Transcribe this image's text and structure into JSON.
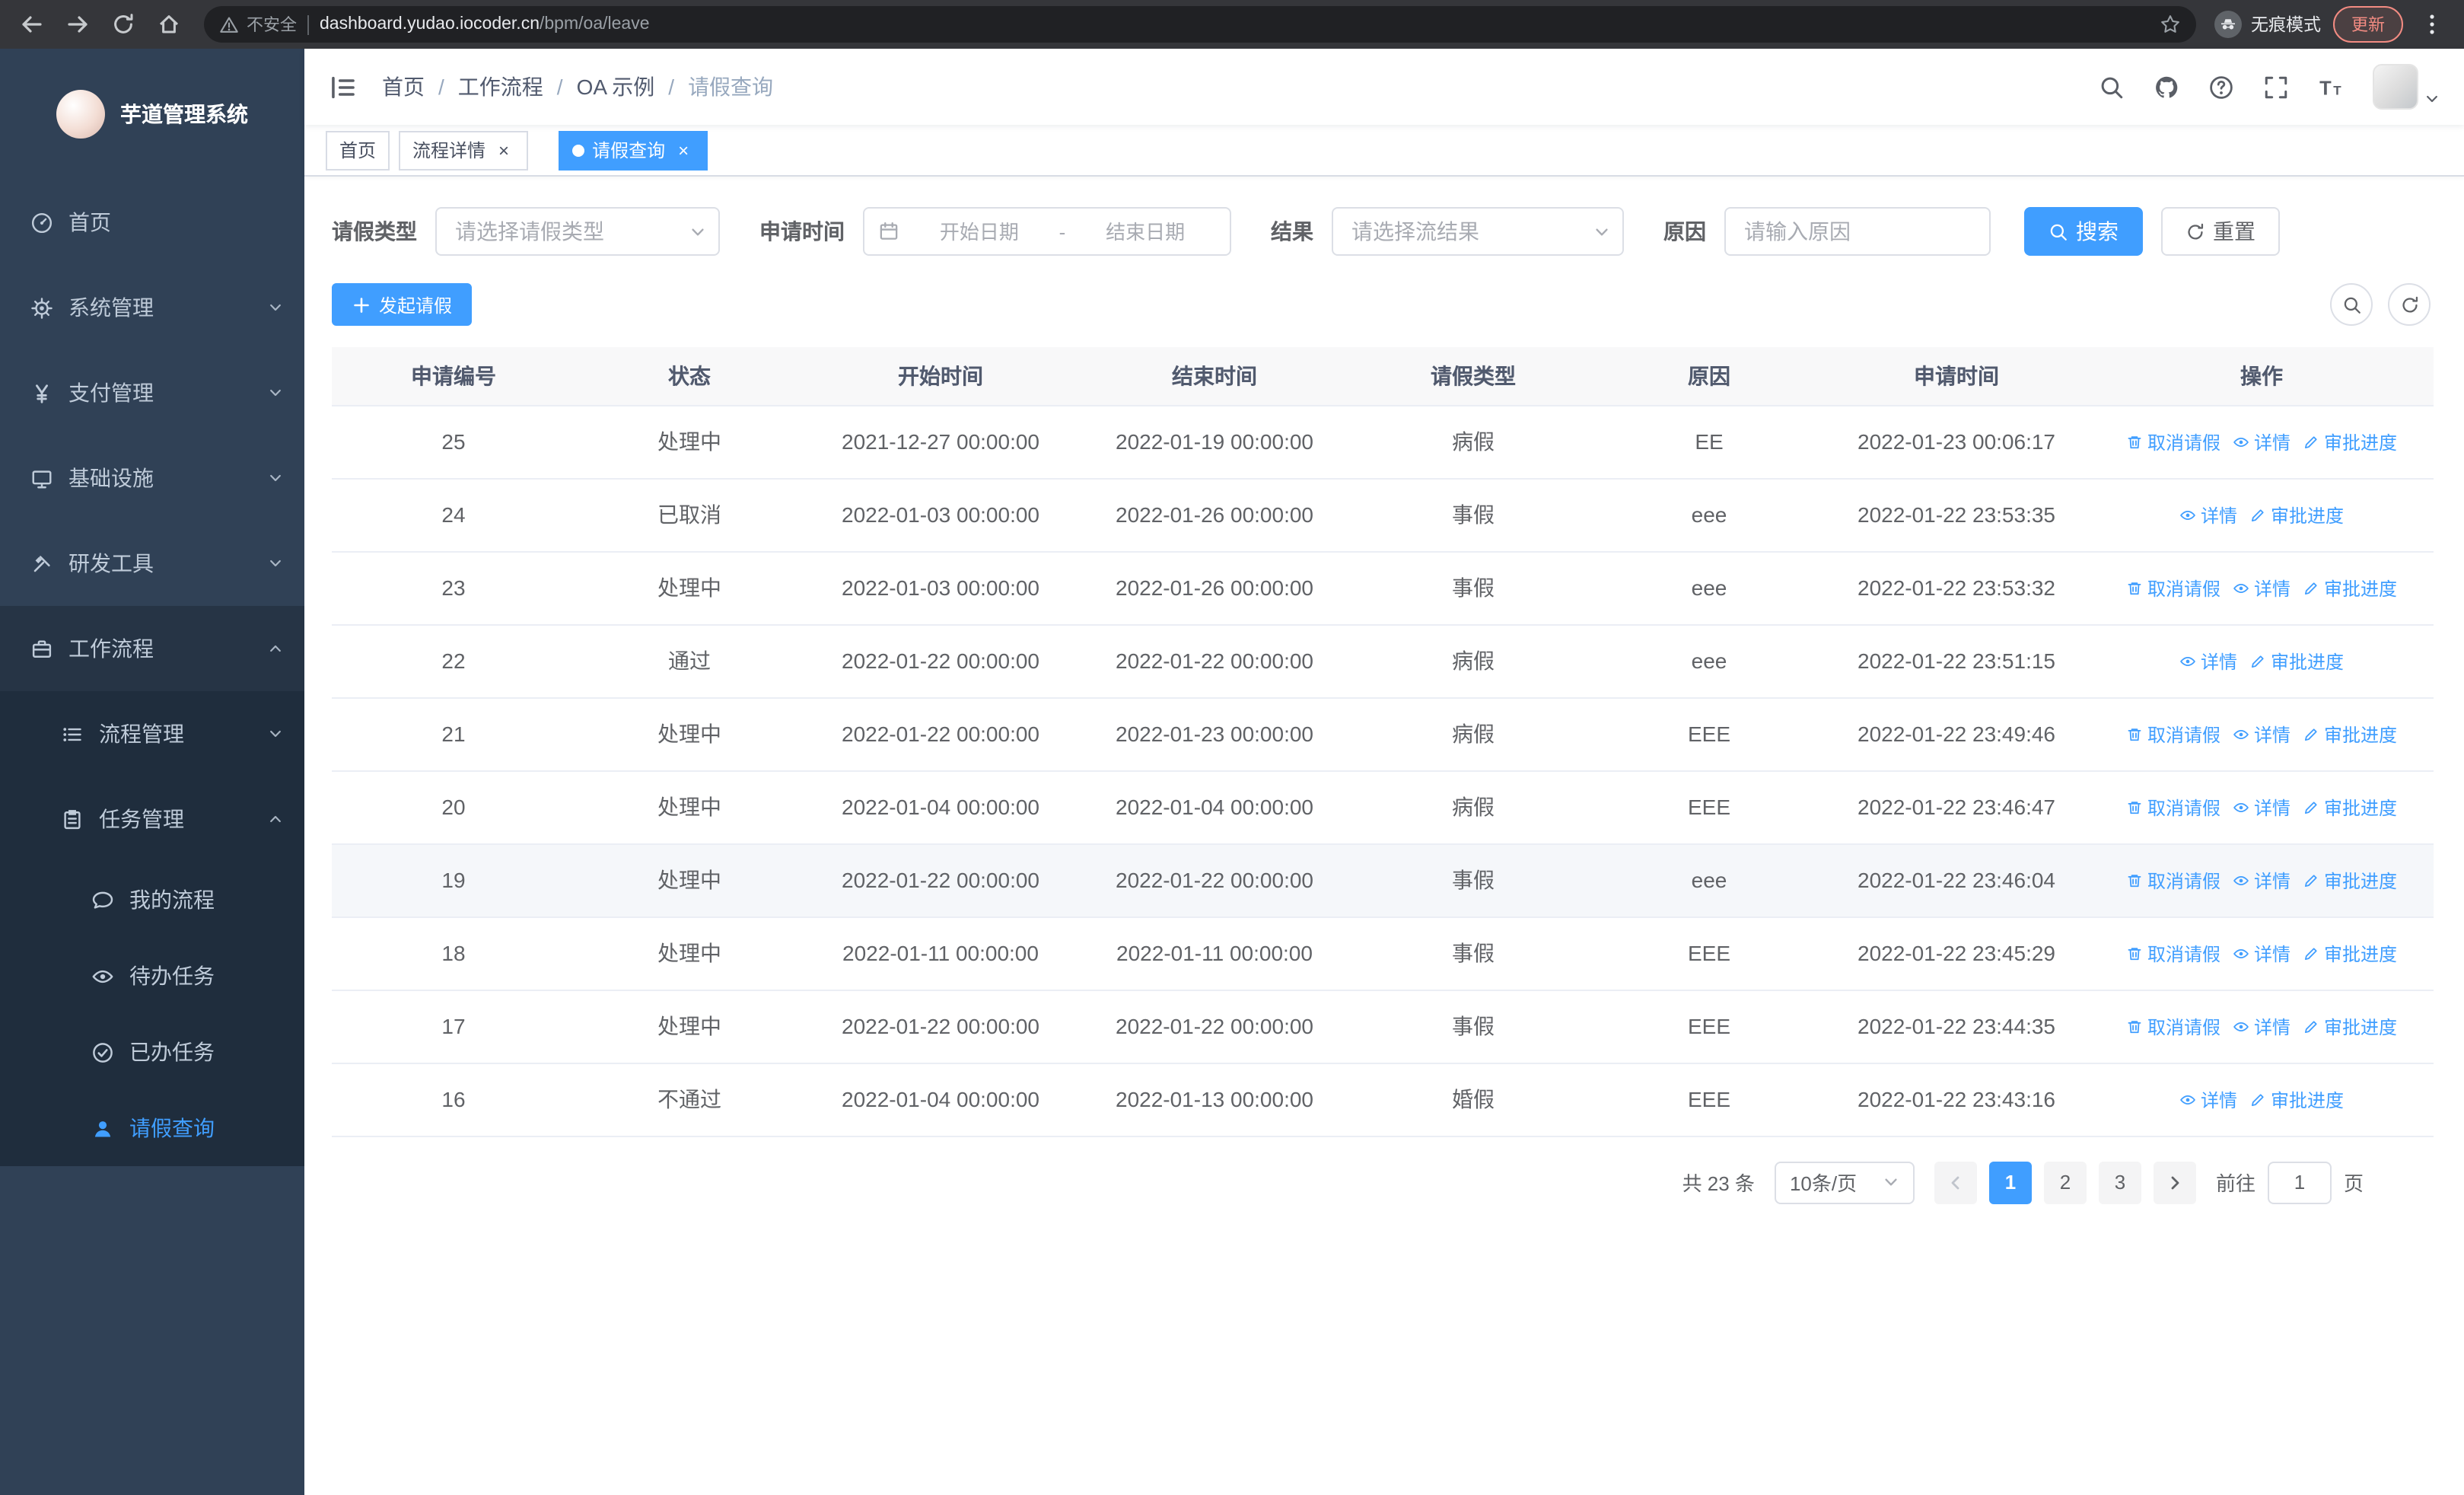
{
  "browser": {
    "security_warning": "不安全",
    "url_host": "dashboard.yudao.iocoder.cn",
    "url_path": "/bpm/oa/leave",
    "incognito_label": "无痕模式",
    "update_button": "更新"
  },
  "sidebar": {
    "app_title": "芋道管理系统",
    "items": [
      {
        "key": "home",
        "label": "首页",
        "icon": "dashboard-icon",
        "level": 1
      },
      {
        "key": "system-management",
        "label": "系统管理",
        "icon": "gear-icon",
        "level": 1,
        "expandable": true
      },
      {
        "key": "payment-management",
        "label": "支付管理",
        "icon": "yen-icon",
        "level": 1,
        "expandable": true
      },
      {
        "key": "infrastructure",
        "label": "基础设施",
        "icon": "monitor-icon",
        "level": 1,
        "expandable": true
      },
      {
        "key": "dev-tools",
        "label": "研发工具",
        "icon": "tools-icon",
        "level": 1,
        "expandable": true
      },
      {
        "key": "workflow",
        "label": "工作流程",
        "icon": "briefcase-icon",
        "level": 1,
        "expandable": true,
        "expanded": true
      },
      {
        "key": "process-management",
        "label": "流程管理",
        "icon": "list-icon",
        "level": 2,
        "expandable": true
      },
      {
        "key": "task-management",
        "label": "任务管理",
        "icon": "clipboard-icon",
        "level": 2,
        "expandable": true,
        "expanded": true
      },
      {
        "key": "my-process",
        "label": "我的流程",
        "icon": "chat-icon",
        "level": 3
      },
      {
        "key": "todo-tasks",
        "label": "待办任务",
        "icon": "eye-icon",
        "level": 3
      },
      {
        "key": "done-tasks",
        "label": "已办任务",
        "icon": "check-icon",
        "level": 3
      },
      {
        "key": "leave-query",
        "label": "请假查询",
        "icon": "user-icon",
        "level": 3,
        "active": true
      }
    ]
  },
  "header": {
    "breadcrumb": [
      "首页",
      "工作流程",
      "OA 示例",
      "请假查询"
    ]
  },
  "tabs": [
    {
      "key": "home",
      "label": "首页",
      "closable": false,
      "active": false
    },
    {
      "key": "process-detail",
      "label": "流程详情",
      "closable": true,
      "active": false
    },
    {
      "key": "leave-query",
      "label": "请假查询",
      "closable": true,
      "active": true
    }
  ],
  "filters": {
    "leave_type": {
      "label": "请假类型",
      "placeholder": "请选择请假类型"
    },
    "apply_time": {
      "label": "申请时间",
      "start_placeholder": "开始日期",
      "separator": "-",
      "end_placeholder": "结束日期"
    },
    "result": {
      "label": "结果",
      "placeholder": "请选择流结果"
    },
    "reason": {
      "label": "原因",
      "placeholder": "请输入原因"
    },
    "search_button": "搜索",
    "reset_button": "重置"
  },
  "toolbar": {
    "create_button": "发起请假"
  },
  "table": {
    "columns": [
      "申请编号",
      "状态",
      "开始时间",
      "结束时间",
      "请假类型",
      "原因",
      "申请时间",
      "操作"
    ],
    "action_labels": {
      "cancel": "取消请假",
      "detail": "详情",
      "progress": "审批进度"
    },
    "rows": [
      {
        "id": "25",
        "status": "处理中",
        "start": "2021-12-27 00:00:00",
        "end": "2022-01-19 00:00:00",
        "type": "病假",
        "reason": "EE",
        "applied": "2022-01-23 00:06:17",
        "actions": [
          "cancel",
          "detail",
          "progress"
        ]
      },
      {
        "id": "24",
        "status": "已取消",
        "start": "2022-01-03 00:00:00",
        "end": "2022-01-26 00:00:00",
        "type": "事假",
        "reason": "eee",
        "applied": "2022-01-22 23:53:35",
        "actions": [
          "detail",
          "progress"
        ]
      },
      {
        "id": "23",
        "status": "处理中",
        "start": "2022-01-03 00:00:00",
        "end": "2022-01-26 00:00:00",
        "type": "事假",
        "reason": "eee",
        "applied": "2022-01-22 23:53:32",
        "actions": [
          "cancel",
          "detail",
          "progress"
        ]
      },
      {
        "id": "22",
        "status": "通过",
        "start": "2022-01-22 00:00:00",
        "end": "2022-01-22 00:00:00",
        "type": "病假",
        "reason": "eee",
        "applied": "2022-01-22 23:51:15",
        "actions": [
          "detail",
          "progress"
        ]
      },
      {
        "id": "21",
        "status": "处理中",
        "start": "2022-01-22 00:00:00",
        "end": "2022-01-23 00:00:00",
        "type": "病假",
        "reason": "EEE",
        "applied": "2022-01-22 23:49:46",
        "actions": [
          "cancel",
          "detail",
          "progress"
        ]
      },
      {
        "id": "20",
        "status": "处理中",
        "start": "2022-01-04 00:00:00",
        "end": "2022-01-04 00:00:00",
        "type": "病假",
        "reason": "EEE",
        "applied": "2022-01-22 23:46:47",
        "actions": [
          "cancel",
          "detail",
          "progress"
        ]
      },
      {
        "id": "19",
        "status": "处理中",
        "start": "2022-01-22 00:00:00",
        "end": "2022-01-22 00:00:00",
        "type": "事假",
        "reason": "eee",
        "applied": "2022-01-22 23:46:04",
        "actions": [
          "cancel",
          "detail",
          "progress"
        ],
        "highlighted": true
      },
      {
        "id": "18",
        "status": "处理中",
        "start": "2022-01-11 00:00:00",
        "end": "2022-01-11 00:00:00",
        "type": "事假",
        "reason": "EEE",
        "applied": "2022-01-22 23:45:29",
        "actions": [
          "cancel",
          "detail",
          "progress"
        ]
      },
      {
        "id": "17",
        "status": "处理中",
        "start": "2022-01-22 00:00:00",
        "end": "2022-01-22 00:00:00",
        "type": "事假",
        "reason": "EEE",
        "applied": "2022-01-22 23:44:35",
        "actions": [
          "cancel",
          "detail",
          "progress"
        ]
      },
      {
        "id": "16",
        "status": "不通过",
        "start": "2022-01-04 00:00:00",
        "end": "2022-01-13 00:00:00",
        "type": "婚假",
        "reason": "EEE",
        "applied": "2022-01-22 23:43:16",
        "actions": [
          "detail",
          "progress"
        ]
      }
    ]
  },
  "pagination": {
    "total_label": "共 23 条",
    "page_size": "10条/页",
    "pages": [
      "1",
      "2",
      "3"
    ],
    "active_page": "1",
    "goto_label": "前往",
    "goto_value": "1",
    "goto_unit": "页"
  },
  "colors": {
    "accent": "#409eff",
    "sidebar_bg": "#304156",
    "submenu_bg": "#1f2d3d",
    "danger": "#f28b82"
  }
}
